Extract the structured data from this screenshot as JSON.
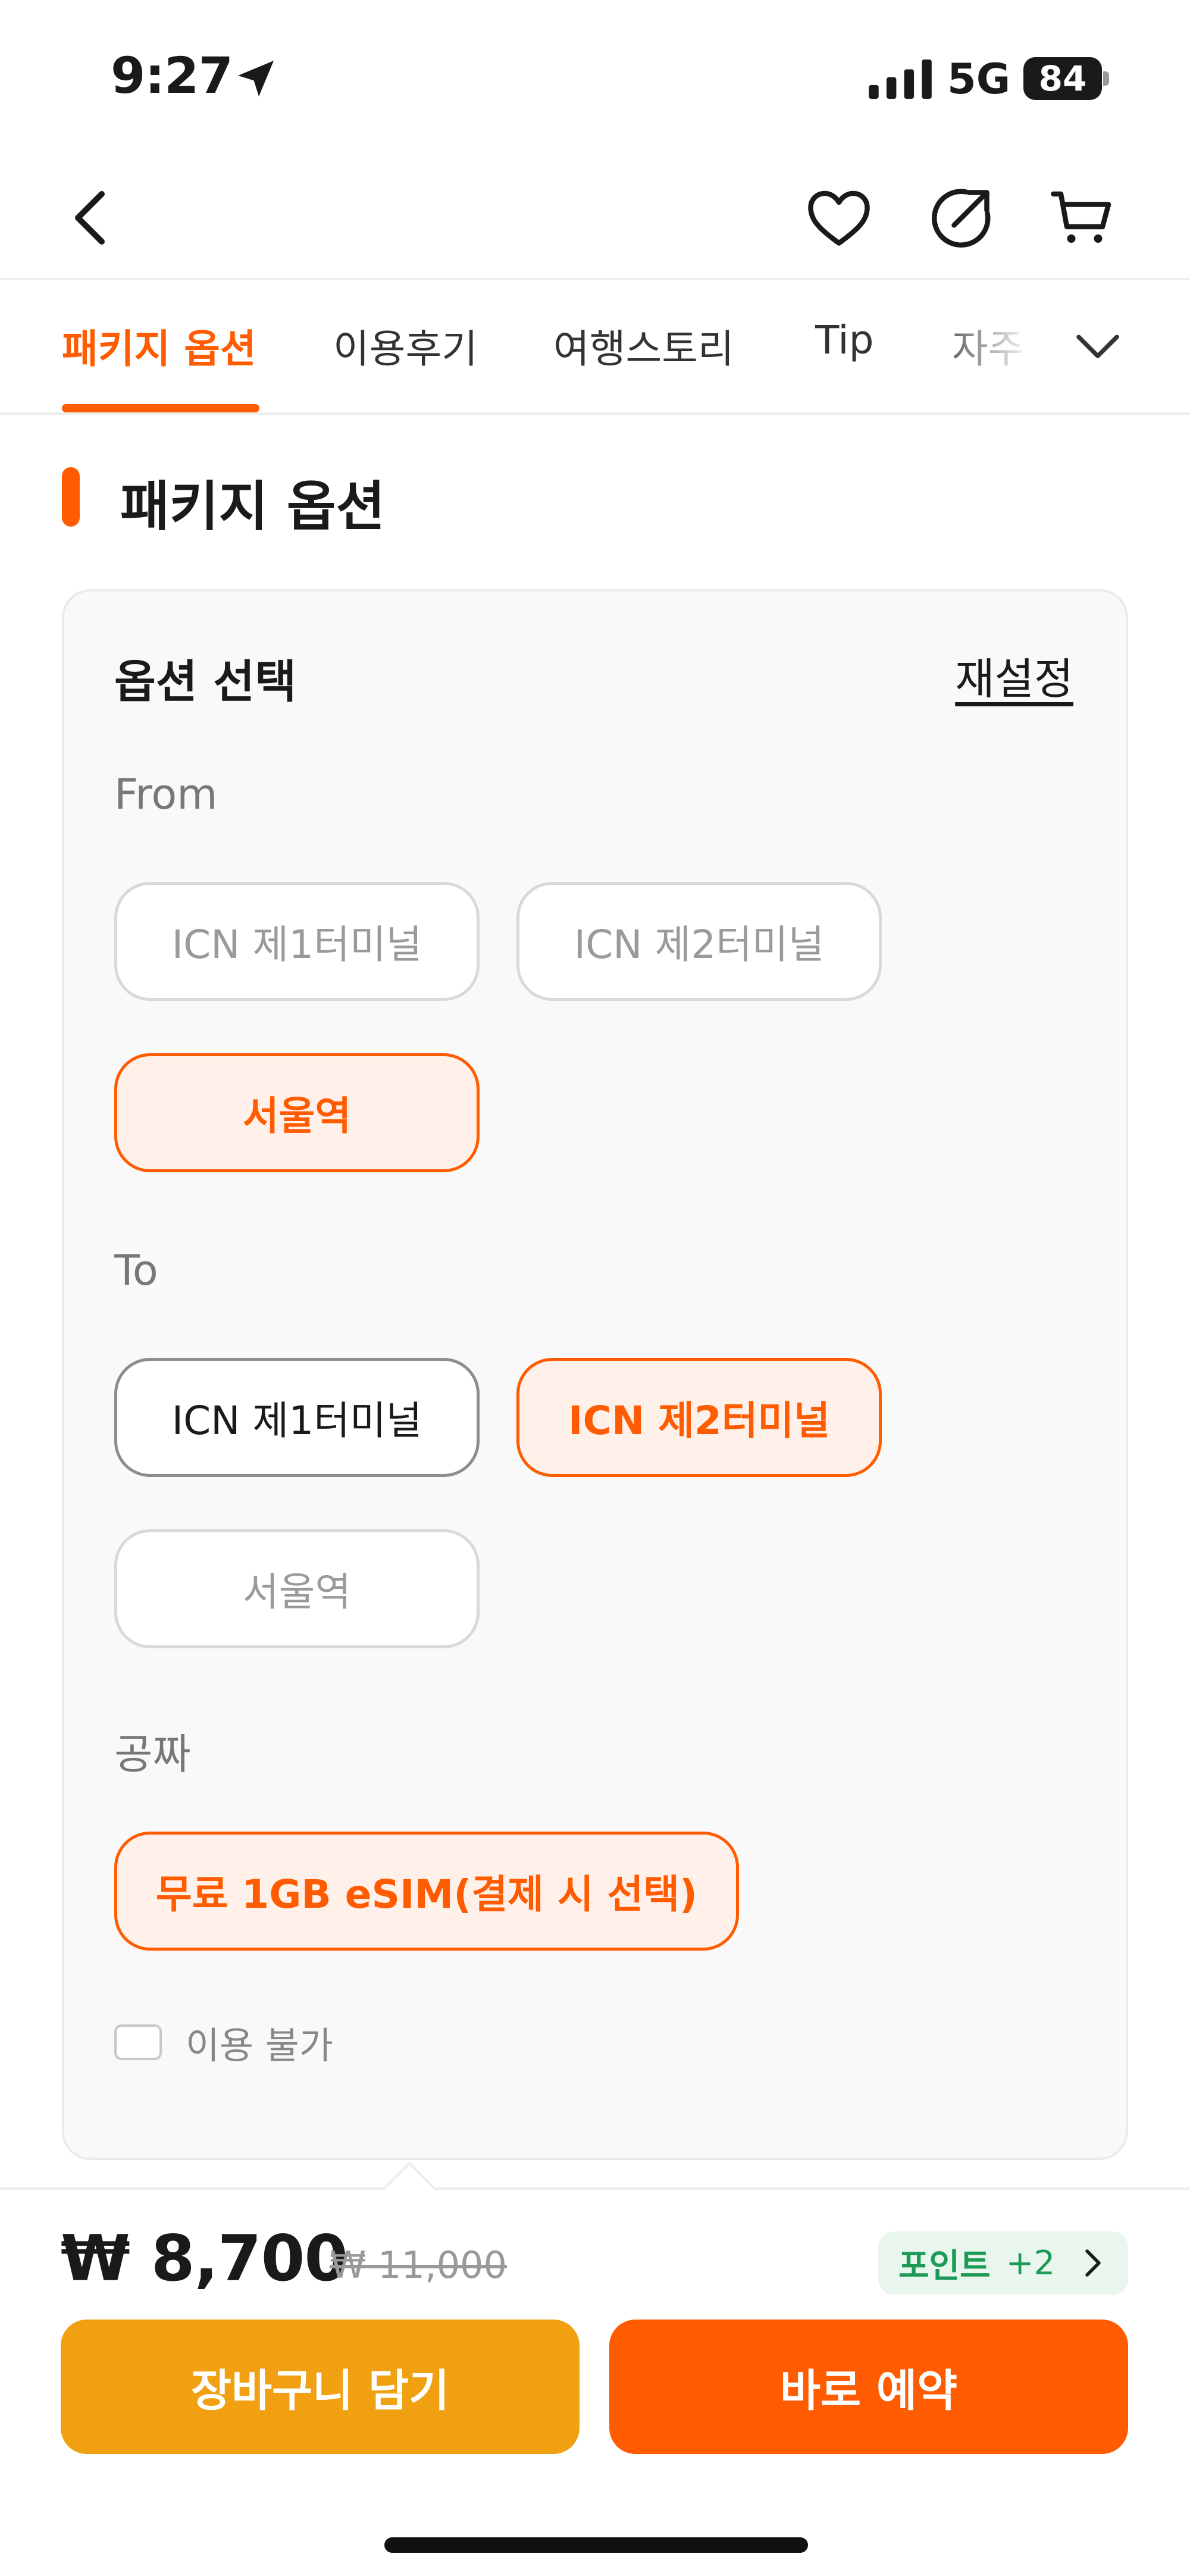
{
  "status_bar": {
    "time": "9:27",
    "network": "5G",
    "battery": "84",
    "icons": [
      "location-arrow-icon",
      "signal-bars-icon",
      "battery-icon"
    ]
  },
  "nav": {
    "icons": [
      "back-chevron-icon",
      "heart-icon",
      "share-icon",
      "cart-icon"
    ]
  },
  "tabs": {
    "items": [
      {
        "label": "패키지 옵션",
        "active": true
      },
      {
        "label": "이용후기",
        "active": false
      },
      {
        "label": "여행스토리",
        "active": false
      },
      {
        "label": "Tip",
        "active": false
      },
      {
        "label": "자주",
        "active": false
      }
    ],
    "more_icon": "chevron-down-icon"
  },
  "section": {
    "title": "패키지 옵션"
  },
  "option_card": {
    "title": "옵션 선택",
    "reset_label": "재설정",
    "from": {
      "label": "From",
      "options": [
        {
          "label": "ICN 제1터미널",
          "state": "disabled"
        },
        {
          "label": "ICN 제2터미널",
          "state": "disabled"
        },
        {
          "label": "서울역",
          "state": "selected"
        }
      ]
    },
    "to": {
      "label": "To",
      "options": [
        {
          "label": "ICN 제1터미널",
          "state": "available"
        },
        {
          "label": "ICN 제2터미널",
          "state": "selected"
        },
        {
          "label": "서울역",
          "state": "disabled"
        }
      ]
    },
    "freebie": {
      "label": "공짜",
      "options": [
        {
          "label": "무료 1GB eSIM(결제 시 선택)",
          "state": "selected"
        }
      ]
    },
    "unavailable_checkbox": {
      "label": "이용 불가",
      "checked": false
    }
  },
  "bottom_bar": {
    "price": "₩ 8,700",
    "original_price": "₩ 11,000",
    "points_label": "포인트",
    "points_value": "+2",
    "add_to_cart_label": "장바구니 담기",
    "book_now_label": "바로 예약"
  },
  "colors": {
    "accent": "#ff5b00",
    "accent_soft": "#fff1e9",
    "cart_button": "#f0a010",
    "points_green": "#1d9a55",
    "points_bg": "#e8f6ee"
  }
}
